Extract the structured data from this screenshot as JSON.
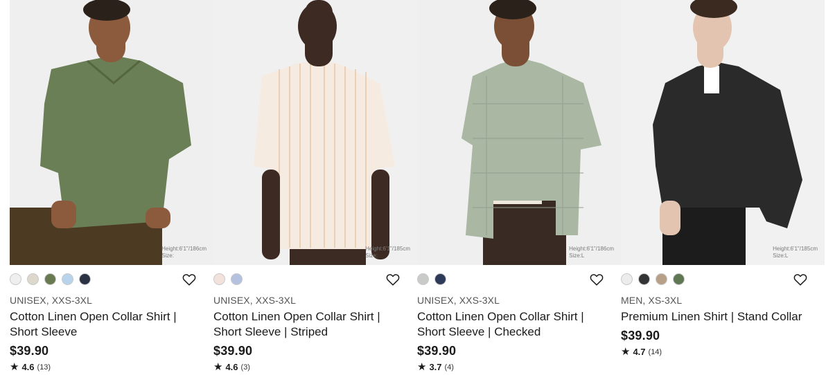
{
  "products": [
    {
      "meta": "UNISEX, XXS-3XL",
      "name": "Cotton Linen Open Collar Shirt | Short Sleeve",
      "price": "$39.90",
      "rating": "4.6",
      "reviews": "(13)",
      "height_caption": "Height:6'1\"/186cm",
      "size_caption": "Size:",
      "shirt_color": "#6a7f55",
      "swatches": [
        "#efefef",
        "#dcd8cc",
        "#6a7a50",
        "#b9d3ec",
        "#2a3244"
      ]
    },
    {
      "meta": "UNISEX, XXS-3XL",
      "name": "Cotton Linen Open Collar Shirt | Short Sleeve | Striped",
      "price": "$39.90",
      "rating": "4.6",
      "reviews": "(3)",
      "height_caption": "Height:6'1\"/185cm",
      "size_caption": "Size:",
      "shirt_color": "#f6ebe0",
      "swatches": [
        "#f3e2dc",
        "#b4c2e0"
      ]
    },
    {
      "meta": "UNISEX, XXS-3XL",
      "name": "Cotton Linen Open Collar Shirt | Short Sleeve | Checked",
      "price": "$39.90",
      "rating": "3.7",
      "reviews": "(4)",
      "height_caption": "Height:6'1\"/186cm",
      "size_caption": "Size:L",
      "shirt_color": "#a9b7a3",
      "swatches": [
        "#c9cbc8",
        "#2e3a5a"
      ]
    },
    {
      "meta": "MEN, XS-3XL",
      "name": "Premium Linen Shirt | Stand Collar",
      "price": "$39.90",
      "rating": "4.7",
      "reviews": "(14)",
      "height_caption": "Height:6'1\"/185cm",
      "size_caption": "Size:L",
      "shirt_color": "#2a2a2a",
      "swatches": [
        "#ececec",
        "#333436",
        "#b8a088",
        "#5f7752"
      ]
    }
  ],
  "icons": {
    "wishlist": "heart-outline-icon",
    "rating": "star-icon"
  }
}
